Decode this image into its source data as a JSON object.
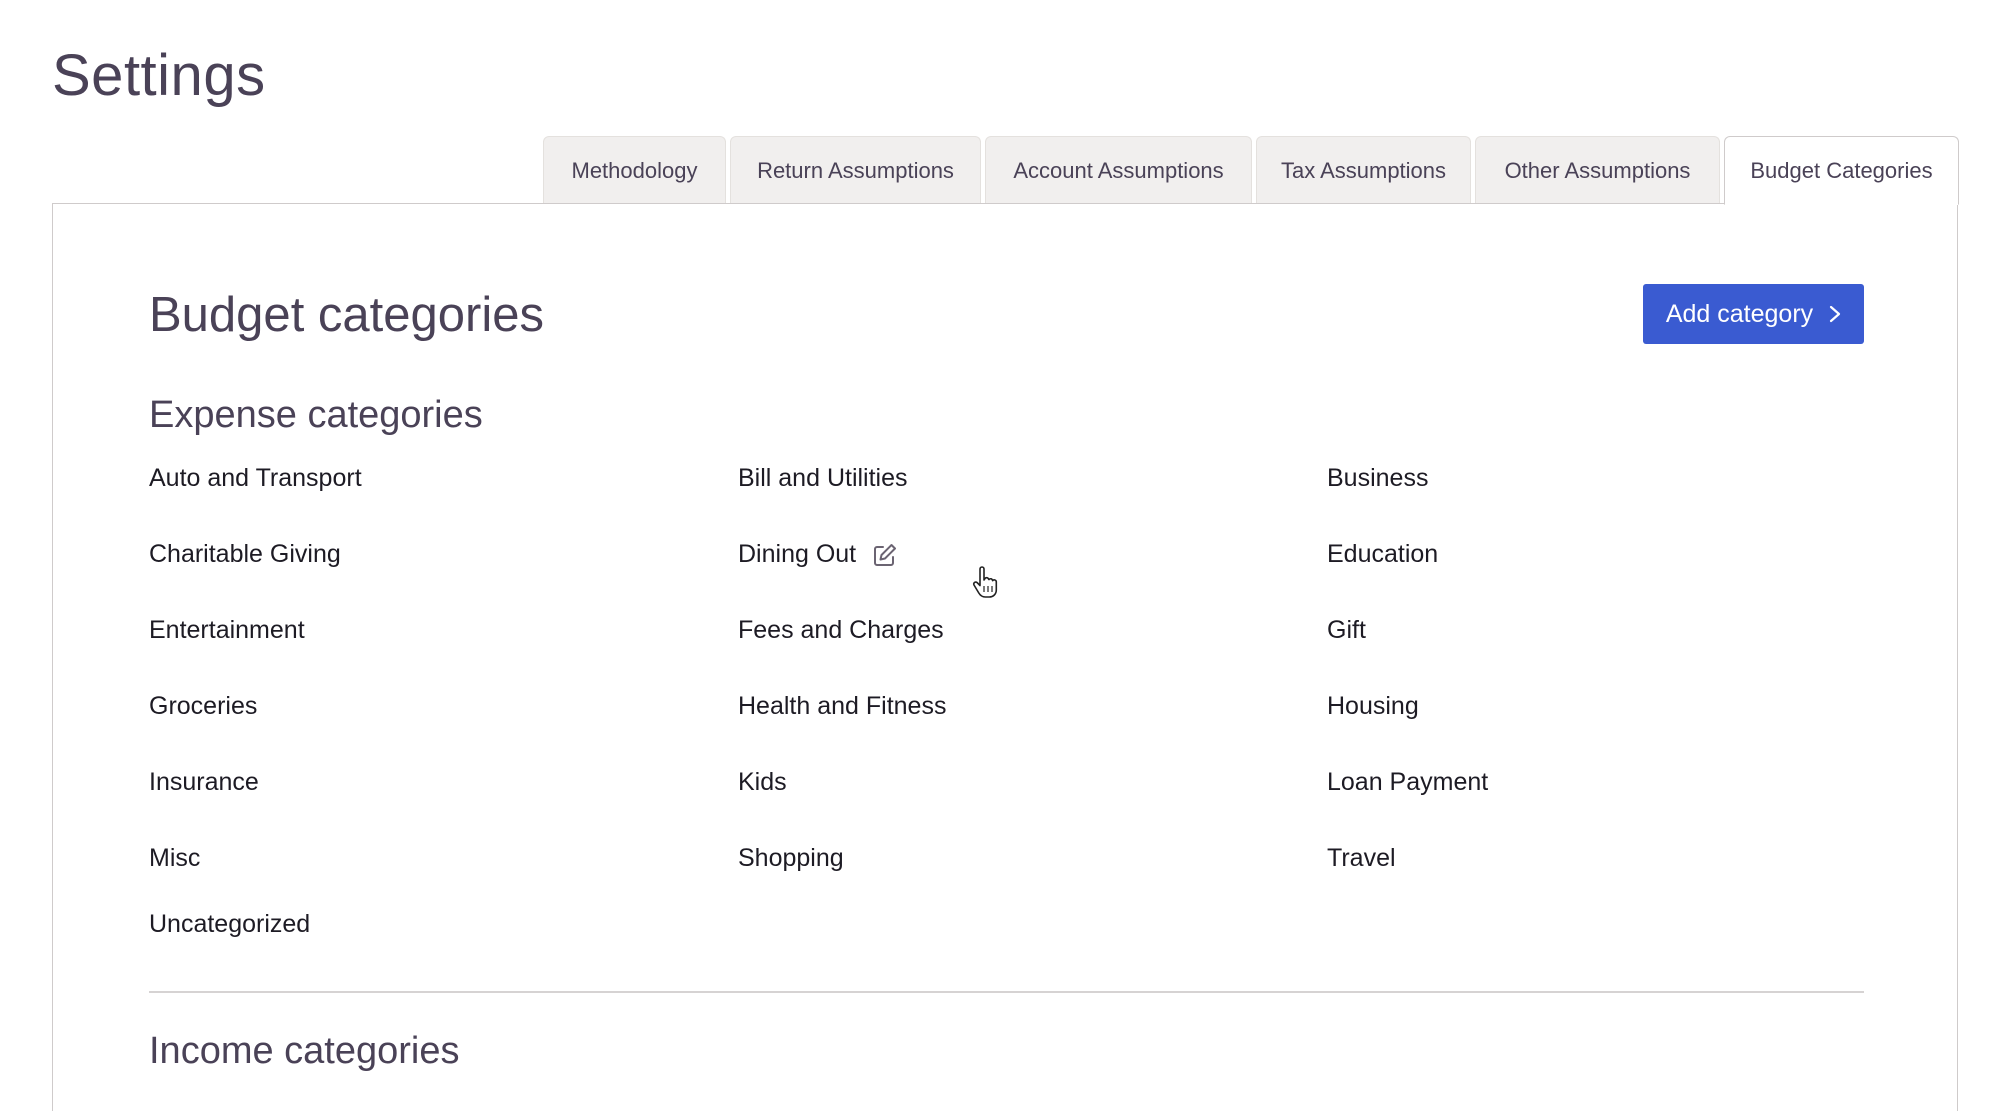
{
  "page": {
    "title": "Settings"
  },
  "tabs": [
    {
      "label": "Methodology"
    },
    {
      "label": "Return Assumptions"
    },
    {
      "label": "Account Assumptions"
    },
    {
      "label": "Tax Assumptions"
    },
    {
      "label": "Other Assumptions"
    },
    {
      "label": "Budget Categories",
      "active": true
    }
  ],
  "budget": {
    "title": "Budget categories",
    "add_button_label": "Add category",
    "expense_title": "Expense categories",
    "income_title": "Income categories",
    "expense_categories": [
      "Auto and Transport",
      "Bill and Utilities",
      "Business",
      "Charitable Giving",
      "Dining Out",
      "Education",
      "Entertainment",
      "Fees and Charges",
      "Gift",
      "Groceries",
      "Health and Fitness",
      "Housing",
      "Insurance",
      "Kids",
      "Loan Payment",
      "Misc",
      "Shopping",
      "Travel",
      "Uncategorized"
    ]
  },
  "icons": {
    "edit": "edit-icon",
    "cursor": "hand-cursor-icon",
    "chevron": "chevron-right-icon"
  },
  "colors": {
    "accent": "#3a5bd1",
    "heading": "#4a4257",
    "tab_bg": "#f1efee"
  }
}
